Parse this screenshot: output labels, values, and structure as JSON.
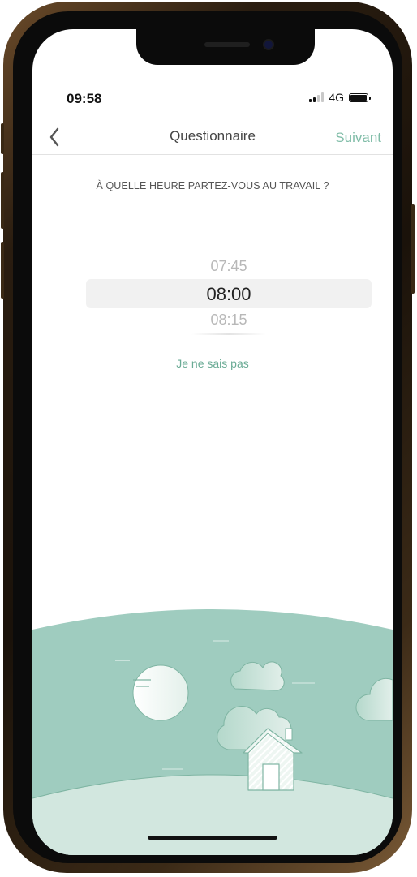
{
  "status_bar": {
    "time": "09:58",
    "network": "4G"
  },
  "nav": {
    "back_icon": "chevron-left-icon",
    "title": "Questionnaire",
    "next_label": "Suivant"
  },
  "question": {
    "text": "À QUELLE HEURE PARTEZ-VOUS AU TRAVAIL ?"
  },
  "time_picker": {
    "previous": "07:45",
    "selected": "08:00",
    "next": "08:15"
  },
  "unknown_link": "Je ne sais pas",
  "colors": {
    "accent": "#7fbca7",
    "illustration": "#9fccbf",
    "ground": "#d2e7df"
  }
}
